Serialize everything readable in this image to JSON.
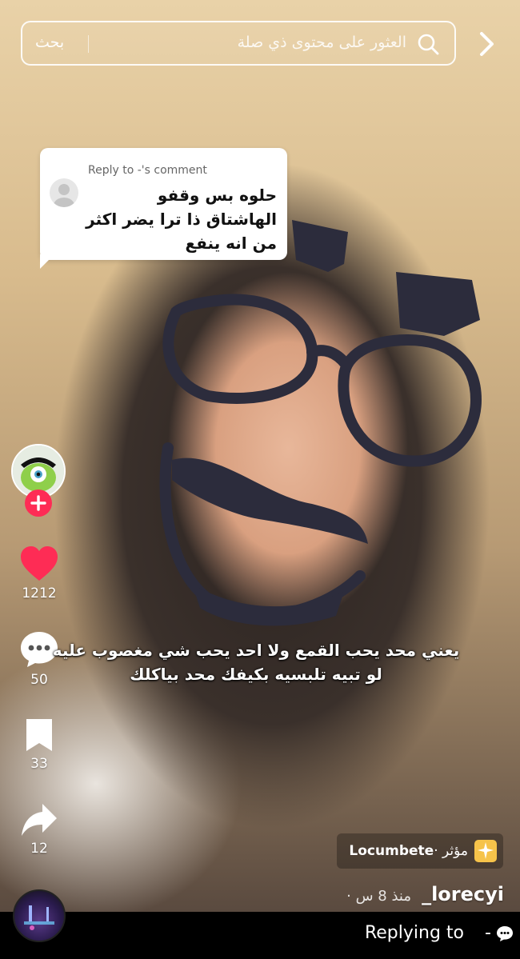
{
  "search": {
    "placeholder": "العثور على محتوى ذي صلة",
    "button_label": "بحث"
  },
  "reply_card": {
    "header": "Reply to -'s comment",
    "body": "حلوه بس وقفو الهاشتاق ذا ترا يضر اكثر من انه ينفع"
  },
  "actions": {
    "likes": "1212",
    "comments": "50",
    "saves": "33",
    "shares": "12"
  },
  "caption": {
    "line1": "يعني محد يحب القمع ولا احد يحب شي مغصوب عليه",
    "line2": "لو تبيه تلبسيه بكيفك محد بياكلك"
  },
  "effect": {
    "prefix": "مؤثر ·",
    "name": "Locumbete"
  },
  "author": {
    "username": "lorecyi_",
    "time": "منذ 8 س ·"
  },
  "bottom_bar": {
    "label": "Replying to",
    "dash": "-"
  },
  "colors": {
    "like": "#fe2c55",
    "follow": "#fe2c55",
    "bottom_bar": "#000000"
  },
  "icons": [
    "chevron-right-icon",
    "search-icon",
    "heart-icon",
    "comment-icon",
    "bookmark-icon",
    "share-icon",
    "plus-icon",
    "effect-sparkle-icon",
    "chat-bubble-icon"
  ]
}
